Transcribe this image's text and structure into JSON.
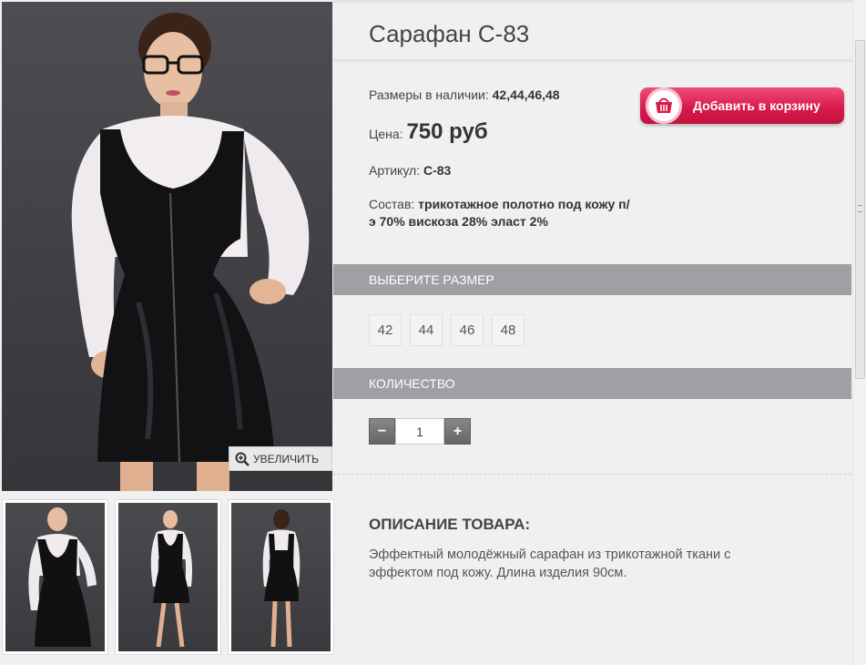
{
  "product": {
    "title": "Сарафан С-83",
    "sizes_label": "Размеры в наличии:",
    "sizes_value": "42,44,46,48",
    "price_label": "Цена:",
    "price_value": "750 руб",
    "article_label": "Артикул:",
    "article_value": "С-83",
    "composition_label": "Состав:",
    "composition_value": "трикотажное полотно под кожу п/э 70% вискоза 28% эласт 2%"
  },
  "cart": {
    "button_label": "Добавить в корзину",
    "icon": "basket-icon"
  },
  "gallery": {
    "zoom_label": "УВЕЛИЧИТЬ",
    "zoom_icon": "zoom-in-icon",
    "thumbnail_count": 3
  },
  "size_section": {
    "title": "Выберите размер",
    "options": [
      "42",
      "44",
      "46",
      "48"
    ]
  },
  "quantity_section": {
    "title": "Количество",
    "minus": "−",
    "plus": "+",
    "value": "1"
  },
  "description": {
    "title": "Описание товара:",
    "text": "Эффектный молодёжный сарафан из трикотажной ткани с эффектом под кожу. Длина изделия 90см."
  },
  "colors": {
    "cart_button": "#d81b4c",
    "section_bar": "#9ea0a4",
    "background": "#f0f0f0"
  }
}
